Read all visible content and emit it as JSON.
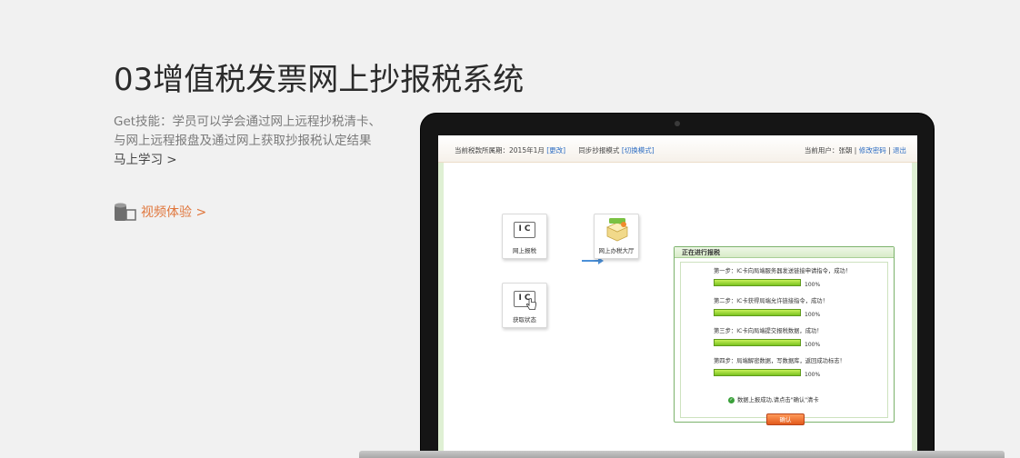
{
  "page": {
    "title": "03增值税发票网上抄报税系统",
    "desc_line1": "Get技能：学员可以学会通过网上远程抄税清卡、",
    "desc_line2": "与网上远程报盘及通过网上获取抄报税认定结果",
    "learn_link": "马上学习 >",
    "video_link": "视频体验 >"
  },
  "screen": {
    "period_label": "当前税款所属期：2015年1月",
    "period_change": "[更改]",
    "mode_label": "同步抄报模式",
    "mode_switch": "[切换模式]",
    "user_label": "当前用户：张朝",
    "change_password": "修改密码",
    "logout": "退出",
    "tiles": {
      "online_report_ic": "I C",
      "online_report": "网上报税",
      "hall": "网上办税大厅",
      "status_ic": "I C",
      "status": "获取状态"
    },
    "panel": {
      "title": "正在进行报税",
      "steps": [
        {
          "text": "第一步：IC卡向局端服务器发送链接申请指令，成功！",
          "percent": "100%"
        },
        {
          "text": "第二步：IC卡获得局端允许链接指令，成功！",
          "percent": "100%"
        },
        {
          "text": "第三步：IC卡向局端提交报税数据，成功！",
          "percent": "100%"
        },
        {
          "text": "第四步：局端解密数据，写数据库，返回成功标志！",
          "percent": "100%"
        }
      ],
      "done_message": "数据上报成功,请点击\"确认\"清卡",
      "confirm": "确认"
    }
  },
  "colors": {
    "accent": "#e0763c",
    "link_blue": "#2c6cc2",
    "progress_green": "#7bc21f"
  }
}
